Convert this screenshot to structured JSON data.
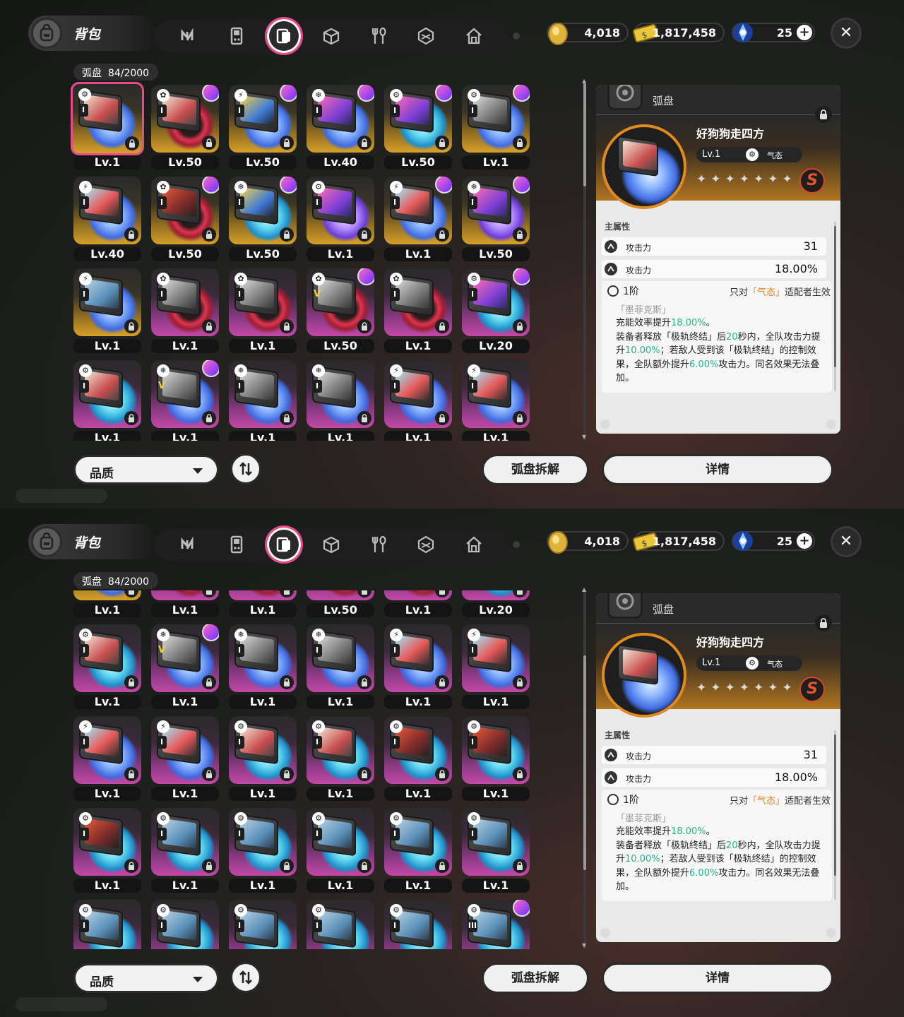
{
  "header": {
    "title": "背包",
    "tabs": [
      {
        "icon": "n-logo-icon"
      },
      {
        "icon": "handheld-console-icon"
      },
      {
        "icon": "disc-case-icon",
        "active": true
      },
      {
        "icon": "box-icon"
      },
      {
        "icon": "fork-spoon-icon"
      },
      {
        "icon": "cube-emblem-icon"
      },
      {
        "icon": "house-icon"
      }
    ],
    "currency": [
      {
        "name": "coin",
        "icon": "gold-coin-icon",
        "value": "4,018"
      },
      {
        "name": "dennies",
        "icon": "ticket-icon",
        "value": "1,817,458"
      },
      {
        "name": "polychrome",
        "icon": "blue-crystal-icon",
        "value": "25"
      }
    ],
    "close": "✕"
  },
  "inventory": {
    "category": "弧盘",
    "count": "84/2000"
  },
  "footer": {
    "sort_select": "品质",
    "dismantle": "弧盘拆解",
    "detail": "详情"
  },
  "detail_panel": {
    "type_label": "弧盘",
    "name": "好狗狗走四方",
    "level": "Lv.1",
    "attribute": "气态",
    "rank": "S",
    "main_stat_title": "主属性",
    "stats": [
      {
        "label": "攻击力",
        "value": "31"
      },
      {
        "label": "攻击力",
        "value": "18.00%"
      }
    ],
    "set": {
      "tier": "1阶",
      "cond_pre": "只对",
      "cond_hl": "「气态」",
      "cond_post": "适配者生效",
      "name": "「墨菲克斯」",
      "desc": [
        {
          "t": "充能效率提升",
          "g": false
        },
        {
          "t": "18.00%",
          "g": true
        },
        {
          "t": "。\n装备者释放「极轨终结」后",
          "g": false
        },
        {
          "t": "20",
          "g": true
        },
        {
          "t": "秒内，全队攻击力提升",
          "g": false
        },
        {
          "t": "10.00%",
          "g": true
        },
        {
          "t": "；若敌人受到该「极轨终结」的控制效果，全队额外提升",
          "g": false
        },
        {
          "t": "6.00%",
          "g": true
        },
        {
          "t": "攻击力。同名效果无法叠加。",
          "g": false
        }
      ]
    }
  },
  "grid_top": [
    {
      "level": "Lv.1",
      "bg": "gold",
      "disc": "blue",
      "cover": "a",
      "attr": "⚙",
      "rank": "I",
      "avatar": false,
      "selected": true
    },
    {
      "level": "Lv.50",
      "bg": "gold",
      "disc": "red",
      "cover": "a",
      "attr": "✿",
      "rank": "I",
      "avatar": true
    },
    {
      "level": "Lv.50",
      "bg": "gold",
      "disc": "blue",
      "cover": "c",
      "attr": "⚡",
      "rank": "I",
      "avatar": true
    },
    {
      "level": "Lv.40",
      "bg": "gold",
      "disc": "blue",
      "cover": "b",
      "attr": "❄",
      "rank": "I",
      "avatar": true
    },
    {
      "level": "Lv.50",
      "bg": "gold",
      "disc": "cyan",
      "cover": "b",
      "attr": "⚙",
      "rank": "I",
      "avatar": true
    },
    {
      "level": "Lv.1",
      "bg": "gold",
      "disc": "blue",
      "cover": "e",
      "attr": "⚙",
      "rank": "I",
      "avatar": true
    },
    {
      "level": "Lv.40",
      "bg": "gold",
      "disc": "blue",
      "cover": "d",
      "attr": "⚡",
      "rank": "I",
      "avatar": false
    },
    {
      "level": "Lv.50",
      "bg": "gold",
      "disc": "red",
      "cover": "g",
      "attr": "✿",
      "rank": "I",
      "avatar": true
    },
    {
      "level": "Lv.50",
      "bg": "gold",
      "disc": "cyan",
      "cover": "c",
      "attr": "❄",
      "rank": "I",
      "avatar": true
    },
    {
      "level": "Lv.1",
      "bg": "gold",
      "disc": "purple",
      "cover": "b",
      "attr": "⚙",
      "rank": "I",
      "avatar": false
    },
    {
      "level": "Lv.1",
      "bg": "gold",
      "disc": "blue",
      "cover": "d",
      "attr": "⚡",
      "rank": "I",
      "avatar": true
    },
    {
      "level": "Lv.50",
      "bg": "gold",
      "disc": "purple",
      "cover": "b",
      "attr": "❄",
      "rank": "I",
      "avatar": true
    },
    {
      "level": "Lv.1",
      "bg": "gold",
      "disc": "blue",
      "cover": "f",
      "attr": "⚡",
      "rank": "I",
      "avatar": false
    },
    {
      "level": "Lv.1",
      "bg": "pink",
      "disc": "red",
      "cover": "e",
      "attr": "✿",
      "rank": "I",
      "avatar": false
    },
    {
      "level": "Lv.1",
      "bg": "pink",
      "disc": "red",
      "cover": "e",
      "attr": "✿",
      "rank": "I",
      "avatar": false
    },
    {
      "level": "Lv.50",
      "bg": "pink",
      "disc": "red",
      "cover": "e",
      "attr": "✿",
      "rank": "V",
      "avatar": true
    },
    {
      "level": "Lv.1",
      "bg": "pink",
      "disc": "red",
      "cover": "e",
      "attr": "✿",
      "rank": "I",
      "avatar": false
    },
    {
      "level": "Lv.20",
      "bg": "pink",
      "disc": "cyan",
      "cover": "b",
      "attr": "⚙",
      "rank": "I",
      "avatar": true
    },
    {
      "level": "Lv.1",
      "bg": "pink",
      "disc": "cyan",
      "cover": "a",
      "attr": "⚙",
      "rank": "I",
      "avatar": false
    },
    {
      "level": "Lv.1",
      "bg": "pink",
      "disc": "blue",
      "cover": "e",
      "attr": "❄",
      "rank": "V",
      "avatar": true
    },
    {
      "level": "Lv.1",
      "bg": "pink",
      "disc": "blue",
      "cover": "e",
      "attr": "❄",
      "rank": "I",
      "avatar": false
    },
    {
      "level": "Lv.1",
      "bg": "pink",
      "disc": "blue",
      "cover": "e",
      "attr": "❄",
      "rank": "I",
      "avatar": false
    },
    {
      "level": "Lv.1",
      "bg": "pink",
      "disc": "blue",
      "cover": "d",
      "attr": "⚡",
      "rank": "I",
      "avatar": false
    },
    {
      "level": "Lv.1",
      "bg": "pink",
      "disc": "blue",
      "cover": "d",
      "attr": "⚡",
      "rank": "I",
      "avatar": false
    }
  ],
  "grid_bottom": [
    {
      "level": "Lv.1",
      "bg": "gold",
      "disc": "blue",
      "cover": "f",
      "attr": "⚡",
      "rank": "I",
      "avatar": false
    },
    {
      "level": "Lv.1",
      "bg": "pink",
      "disc": "red",
      "cover": "e",
      "attr": "✿",
      "rank": "I",
      "avatar": false
    },
    {
      "level": "Lv.1",
      "bg": "pink",
      "disc": "red",
      "cover": "e",
      "attr": "✿",
      "rank": "I",
      "avatar": false
    },
    {
      "level": "Lv.50",
      "bg": "pink",
      "disc": "red",
      "cover": "e",
      "attr": "✿",
      "rank": "V",
      "avatar": false
    },
    {
      "level": "Lv.1",
      "bg": "pink",
      "disc": "red",
      "cover": "e",
      "attr": "✿",
      "rank": "I",
      "avatar": false
    },
    {
      "level": "Lv.20",
      "bg": "pink",
      "disc": "cyan",
      "cover": "b",
      "attr": "⚙",
      "rank": "I",
      "avatar": false
    },
    {
      "level": "Lv.1",
      "bg": "pink",
      "disc": "cyan",
      "cover": "a",
      "attr": "⚙",
      "rank": "I",
      "avatar": false
    },
    {
      "level": "Lv.1",
      "bg": "pink",
      "disc": "blue",
      "cover": "e",
      "attr": "❄",
      "rank": "V",
      "avatar": true
    },
    {
      "level": "Lv.1",
      "bg": "pink",
      "disc": "blue",
      "cover": "e",
      "attr": "❄",
      "rank": "I",
      "avatar": false
    },
    {
      "level": "Lv.1",
      "bg": "pink",
      "disc": "blue",
      "cover": "e",
      "attr": "❄",
      "rank": "I",
      "avatar": false
    },
    {
      "level": "Lv.1",
      "bg": "pink",
      "disc": "blue",
      "cover": "d",
      "attr": "⚡",
      "rank": "I",
      "avatar": false
    },
    {
      "level": "Lv.1",
      "bg": "pink",
      "disc": "blue",
      "cover": "d",
      "attr": "⚡",
      "rank": "I",
      "avatar": false
    },
    {
      "level": "Lv.1",
      "bg": "pink",
      "disc": "blue",
      "cover": "d",
      "attr": "⚡",
      "rank": "I",
      "avatar": false
    },
    {
      "level": "Lv.1",
      "bg": "pink",
      "disc": "blue",
      "cover": "d",
      "attr": "⚡",
      "rank": "I",
      "avatar": false
    },
    {
      "level": "Lv.1",
      "bg": "pink",
      "disc": "cyan",
      "cover": "a",
      "attr": "⚙",
      "rank": "I",
      "avatar": false
    },
    {
      "level": "Lv.1",
      "bg": "pink",
      "disc": "cyan",
      "cover": "a",
      "attr": "⚙",
      "rank": "I",
      "avatar": false
    },
    {
      "level": "Lv.1",
      "bg": "pink",
      "disc": "cyan",
      "cover": "g",
      "attr": "⚙",
      "rank": "I",
      "avatar": false
    },
    {
      "level": "Lv.1",
      "bg": "pink",
      "disc": "cyan",
      "cover": "g",
      "attr": "⚙",
      "rank": "I",
      "avatar": false
    },
    {
      "level": "Lv.1",
      "bg": "pink",
      "disc": "cyan",
      "cover": "g",
      "attr": "⚙",
      "rank": "I",
      "avatar": false
    },
    {
      "level": "Lv.1",
      "bg": "pink",
      "disc": "cyan",
      "cover": "f",
      "attr": "⚙",
      "rank": "I",
      "avatar": false
    },
    {
      "level": "Lv.1",
      "bg": "pink",
      "disc": "cyan",
      "cover": "f",
      "attr": "⚙",
      "rank": "I",
      "avatar": false
    },
    {
      "level": "Lv.1",
      "bg": "pink",
      "disc": "cyan",
      "cover": "f",
      "attr": "⚙",
      "rank": "I",
      "avatar": false
    },
    {
      "level": "Lv.1",
      "bg": "pink",
      "disc": "cyan",
      "cover": "f",
      "attr": "⚙",
      "rank": "I",
      "avatar": false
    },
    {
      "level": "Lv.1",
      "bg": "pink",
      "disc": "cyan",
      "cover": "f",
      "attr": "⚙",
      "rank": "I",
      "avatar": false
    },
    {
      "level": "",
      "bg": "pink",
      "disc": "cyan",
      "cover": "f",
      "attr": "⚙",
      "rank": "I",
      "avatar": false
    },
    {
      "level": "",
      "bg": "pink",
      "disc": "cyan",
      "cover": "f",
      "attr": "⚙",
      "rank": "I",
      "avatar": false
    },
    {
      "level": "",
      "bg": "pink",
      "disc": "cyan",
      "cover": "f",
      "attr": "⚙",
      "rank": "I",
      "avatar": false
    },
    {
      "level": "",
      "bg": "pink",
      "disc": "cyan",
      "cover": "f",
      "attr": "⚙",
      "rank": "I",
      "avatar": false
    },
    {
      "level": "",
      "bg": "pink",
      "disc": "cyan",
      "cover": "f",
      "attr": "⚙",
      "rank": "I",
      "avatar": false
    },
    {
      "level": "",
      "bg": "pink",
      "disc": "cyan",
      "cover": "f",
      "attr": "⚙",
      "rank": "III",
      "avatar": true
    }
  ]
}
